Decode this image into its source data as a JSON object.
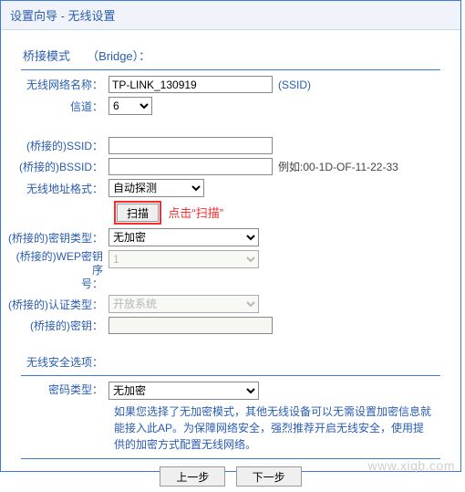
{
  "header": {
    "title": "设置向导 - 无线设置"
  },
  "mode": {
    "label": "桥接模式",
    "paren": "（Bridge）："
  },
  "fields": {
    "ssid_label": "无线网络名称：",
    "ssid_value": "TP-LINK_130919",
    "ssid_suffix": "(SSID)",
    "channel_label": "信道：",
    "channel_value": "6",
    "bridge_ssid_label": "(桥接的)SSID：",
    "bridge_ssid_value": "",
    "bridge_bssid_label": "(桥接的)BSSID：",
    "bridge_bssid_value": "",
    "bssid_example": "例如:00-1D-OF-11-22-33",
    "addr_format_label": "无线地址格式：",
    "addr_format_value": "自动探测",
    "scan_button": "扫描",
    "scan_hint": "点击“扫描”",
    "key_type_label": "(桥接的)密钥类型：",
    "key_type_value": "无加密",
    "wep_index_label1": "(桥接的)WEP密钥序",
    "wep_index_label2": "号：",
    "wep_index_value": "1",
    "auth_label": "(桥接的)认证类型：",
    "auth_value": "开放系统",
    "key_label": "(桥接的)密钥：",
    "key_value": ""
  },
  "security": {
    "option_label": "无线安全选项：",
    "enc_type_label": "密码类型：",
    "enc_type_value": "无加密",
    "note": "如果您选择了无加密模式，其他无线设备可以无需设置加密信息就能接入此AP。为保障网络安全，强烈推荐开启无线安全，使用提供的加密方式配置无线网络。"
  },
  "buttons": {
    "prev": "上一步",
    "next": "下一步"
  },
  "watermark": "www.xiqb.com"
}
